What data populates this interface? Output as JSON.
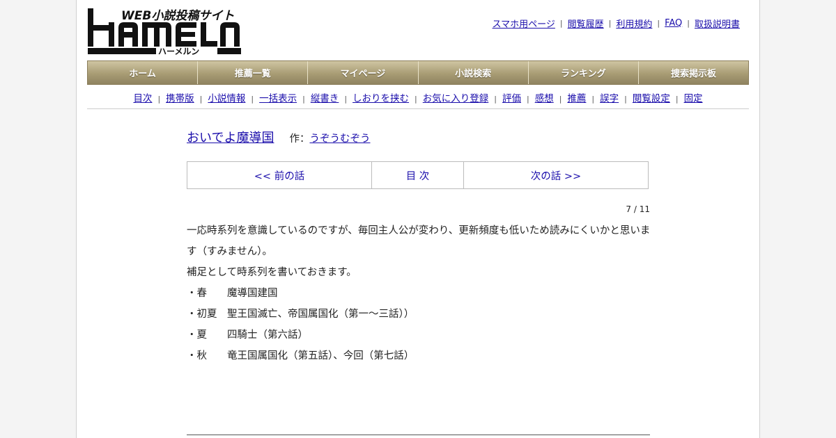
{
  "logo": {
    "tagline": "WEB小説投稿サイト",
    "wordmark": "HAMELN",
    "kana": "ハーメルン"
  },
  "top_links": [
    "スマホ用ページ",
    "閲覧履歴",
    "利用規約",
    "FAQ",
    "取扱説明書"
  ],
  "nav": [
    "ホーム",
    "推薦一覧",
    "マイページ",
    "小説検索",
    "ランキング",
    "捜索掲示板"
  ],
  "subnav": [
    "目次",
    "携帯版",
    "小説情報",
    "一括表示",
    "縦書き",
    "しおりを挟む",
    "お気に入り登録",
    "評価",
    "感想",
    "推薦",
    "誤字",
    "閲覧設定",
    "固定"
  ],
  "novel": {
    "title": "おいでよ魔導国",
    "author_label": "作：",
    "author": "うぞうむぞう"
  },
  "chapter_nav": {
    "prev": "<< 前の話",
    "toc": "目 次",
    "next": "次の話 >>"
  },
  "page_count": "7 / 11",
  "body": [
    "一応時系列を意識しているのですが、毎回主人公が変わり、更新頻度も低いため読みにくいかと思います（すみません）。",
    "補足として時系列を書いておきます。",
    "・春　　魔導国建国",
    "・初夏　聖王国滅亡、帝国属国化（第一～三話））",
    "・夏　　四騎士（第六話）",
    "・秋　　竜王国属国化（第五話）、今回（第七話）"
  ]
}
